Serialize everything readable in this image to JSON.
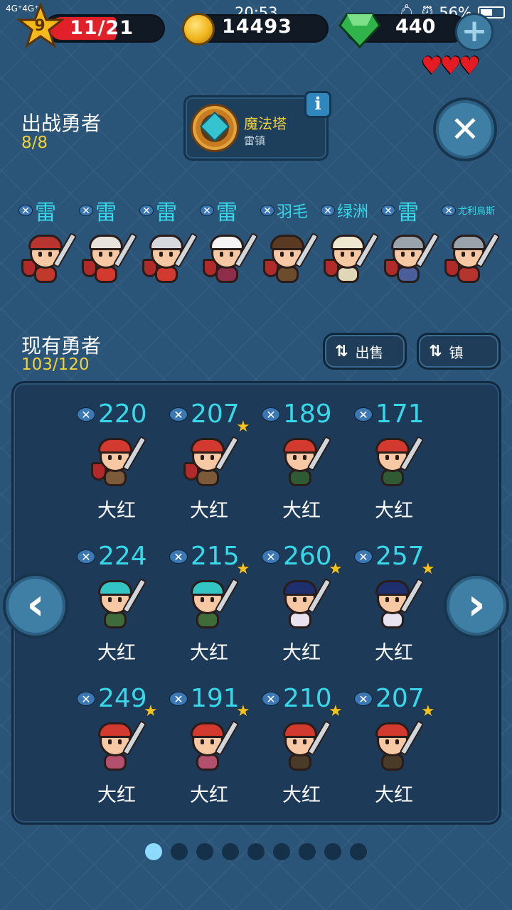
{
  "status_bar": {
    "network": "4G⁺4G⁺",
    "time": "20:53",
    "battery": "56%"
  },
  "resources": {
    "level": "9",
    "xp": "11/21",
    "xp_fraction": 0.52,
    "coins": "14493",
    "gems": "440",
    "hearts": 3
  },
  "deployed": {
    "title": "出战勇者",
    "count": "8/8",
    "tower_name": "魔法塔",
    "tower_sub": "雷镇",
    "info_label": "i",
    "heroes": [
      {
        "label": "雷",
        "colors": {
          "hat": "#b8342e",
          "body": "#c0392b"
        }
      },
      {
        "label": "雷",
        "colors": {
          "hat": "#e8e4dc",
          "body": "#d33a2f"
        }
      },
      {
        "label": "雷",
        "colors": {
          "hat": "#d5d9dd",
          "body": "#d33a2f"
        }
      },
      {
        "label": "雷",
        "colors": {
          "hat": "#f4f4f4",
          "body": "#8f2e4a"
        }
      },
      {
        "label": "羽毛",
        "colors": {
          "hat": "#5a3a22",
          "body": "#6b4c2c"
        }
      },
      {
        "label": "绿洲",
        "colors": {
          "hat": "#efe8d0",
          "body": "#e0d6b8"
        }
      },
      {
        "label": "雷",
        "colors": {
          "hat": "#9aa2ab",
          "body": "#4a5e9a"
        }
      },
      {
        "label": "尤利烏斯",
        "colors": {
          "hat": "#9aa2ab",
          "body": "#b5342e"
        }
      }
    ]
  },
  "owned": {
    "title": "现有勇者",
    "count": "103/120",
    "sort_sell": "出售",
    "sort_town": "镇",
    "heroes": [
      {
        "power": "220",
        "name": "大红",
        "star": false,
        "hat": "#d33a2f",
        "body": "#7d5a3a"
      },
      {
        "power": "207",
        "name": "大红",
        "star": true,
        "hat": "#d33a2f",
        "body": "#7d5a3a"
      },
      {
        "power": "189",
        "name": "大红",
        "star": false,
        "hat": "#d33a2f",
        "body": "#2f5a33"
      },
      {
        "power": "171",
        "name": "大红",
        "star": false,
        "hat": "#d33a2f",
        "body": "#2f5a33"
      },
      {
        "power": "224",
        "name": "大红",
        "star": false,
        "hat": "#33c4c4",
        "body": "#3f6b3a"
      },
      {
        "power": "215",
        "name": "大红",
        "star": true,
        "hat": "#33c4c4",
        "body": "#3f6b3a"
      },
      {
        "power": "260",
        "name": "大红",
        "star": true,
        "hat": "#1e2f6e",
        "body": "#e8e2f0"
      },
      {
        "power": "257",
        "name": "大红",
        "star": true,
        "hat": "#1e2f6e",
        "body": "#e8e2f0"
      },
      {
        "power": "249",
        "name": "大红",
        "star": true,
        "hat": "#d33a2f",
        "body": "#b3506e"
      },
      {
        "power": "191",
        "name": "大红",
        "star": true,
        "hat": "#d33a2f",
        "body": "#b3506e"
      },
      {
        "power": "210",
        "name": "大红",
        "star": true,
        "hat": "#d33a2f",
        "body": "#4a3a28"
      },
      {
        "power": "207",
        "name": "大红",
        "star": true,
        "hat": "#d33a2f",
        "body": "#4a3a28"
      }
    ]
  },
  "pagination": {
    "total": 9,
    "current": 1
  }
}
